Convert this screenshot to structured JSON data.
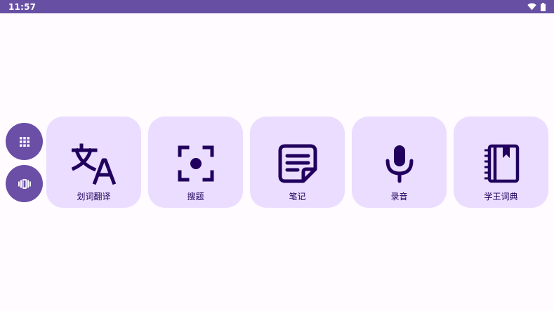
{
  "status_bar": {
    "time": "11:57",
    "icons": [
      "wifi-icon",
      "battery-icon"
    ],
    "background": "#6750a4"
  },
  "side_buttons": [
    {
      "name": "apps-grid-icon"
    },
    {
      "name": "vibrate-icon"
    }
  ],
  "tiles": [
    {
      "label": "划词翻译",
      "icon": "translate-icon"
    },
    {
      "label": "搜题",
      "icon": "camera-focus-icon"
    },
    {
      "label": "笔记",
      "icon": "note-icon"
    },
    {
      "label": "录音",
      "icon": "microphone-icon"
    },
    {
      "label": "学王词典",
      "icon": "dictionary-book-icon"
    }
  ],
  "colors": {
    "tile_background": "#eaddff",
    "icon_color": "#21005d",
    "side_button_background": "#6b4ea6",
    "page_background": "#fffbff"
  }
}
